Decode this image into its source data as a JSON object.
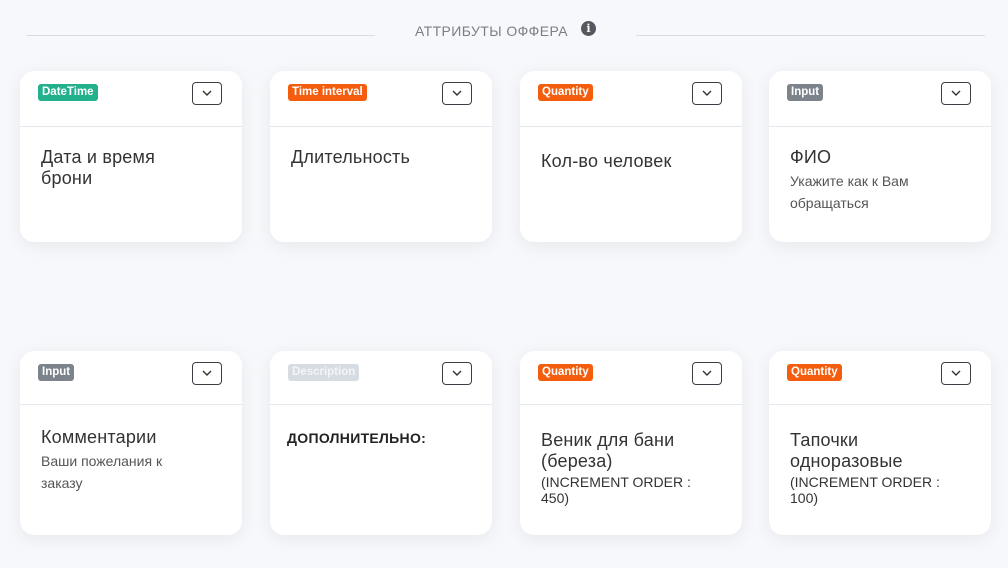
{
  "section": {
    "title": "АТТРИБУТЫ ОФФЕРА",
    "info_icon": "info-icon"
  },
  "cards": [
    {
      "badge": "DateTime",
      "badge_color": "#22b08d",
      "title": "Дата и время брони"
    },
    {
      "badge": "Time interval",
      "badge_color": "#f45d0d",
      "title": "Длительность"
    },
    {
      "badge": "Quantity",
      "badge_color": "#f45d0d",
      "title": "Кол-во человек"
    },
    {
      "badge": "Input",
      "badge_color": "#7c838b",
      "title": "ФИО",
      "subtitle": "Укажите как к Вам обращаться"
    },
    {
      "badge": "Input",
      "badge_color": "#7c838b",
      "title": "Комментарии",
      "subtitle": "Ваши пожелания к заказу"
    },
    {
      "badge": "Description",
      "badge_color": "#d7dce2",
      "title": "ДОПОЛНИТЕЛЬНО:"
    },
    {
      "badge": "Quantity",
      "badge_color": "#f45d0d",
      "title": "Веник для бани (береза)",
      "note": "(INCREMENT ORDER : 450)"
    },
    {
      "badge": "Quantity",
      "badge_color": "#f45d0d",
      "title": "Тапочки одноразовые",
      "note": "(INCREMENT ORDER : 100)"
    }
  ]
}
